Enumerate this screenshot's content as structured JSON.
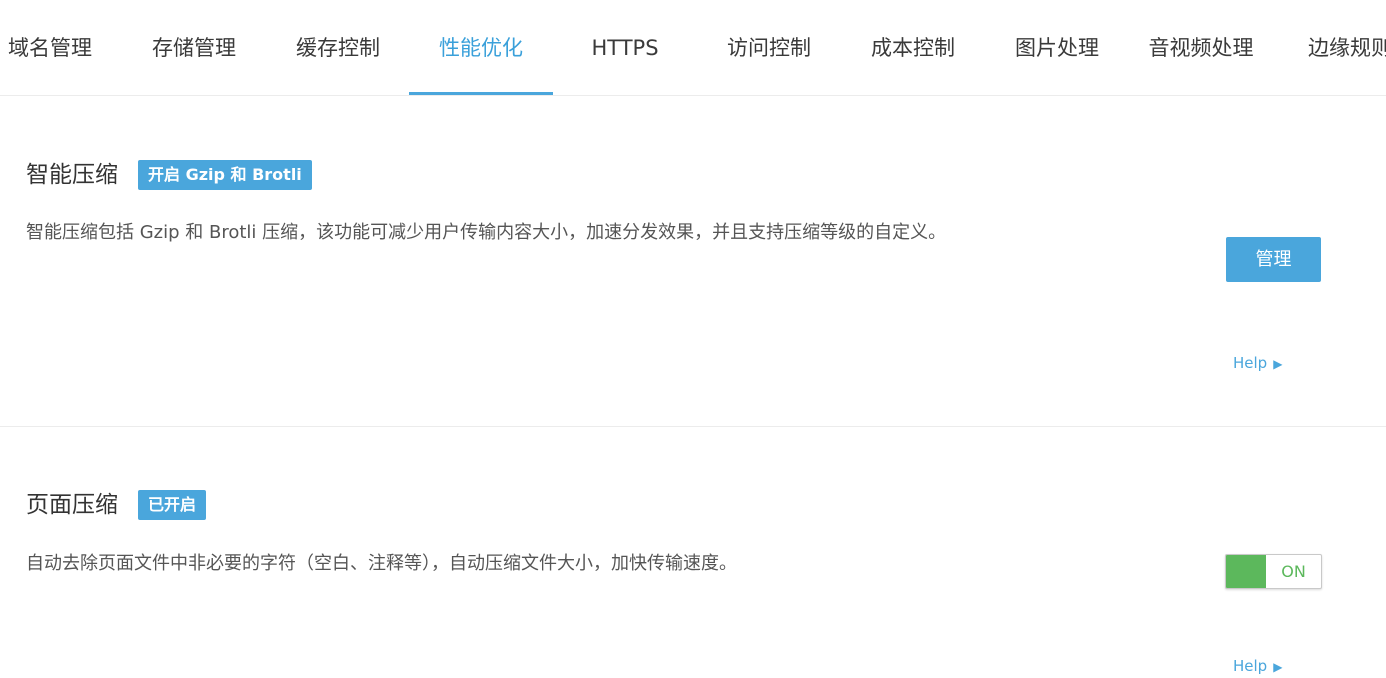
{
  "tabs": [
    {
      "label": "域名管理"
    },
    {
      "label": "存储管理"
    },
    {
      "label": "缓存控制"
    },
    {
      "label": "性能优化",
      "active": true
    },
    {
      "label": "HTTPS"
    },
    {
      "label": "访问控制"
    },
    {
      "label": "成本控制"
    },
    {
      "label": "图片处理"
    },
    {
      "label": "音视频处理"
    },
    {
      "label": "边缘规则"
    }
  ],
  "smart_compression": {
    "title": "智能压缩",
    "badge": "开启 Gzip 和 Brotli",
    "description": "智能压缩包括 Gzip 和 Brotli 压缩，该功能可减少用户传输内容大小，加速分发效果，并且支持压缩等级的自定义。",
    "manage_label": "管理",
    "help_label": "Help"
  },
  "page_compression": {
    "title": "页面压缩",
    "badge": "已开启",
    "description": "自动去除页面文件中非必要的字符（空白、注释等），自动压缩文件大小，加快传输速度。",
    "toggle_label": "ON",
    "toggle_on": true,
    "help_label": "Help"
  },
  "colors": {
    "accent": "#4aa6dc",
    "toggle_on": "#5cb85c"
  },
  "icons": {
    "help_arrow": "triangle-right-icon"
  }
}
